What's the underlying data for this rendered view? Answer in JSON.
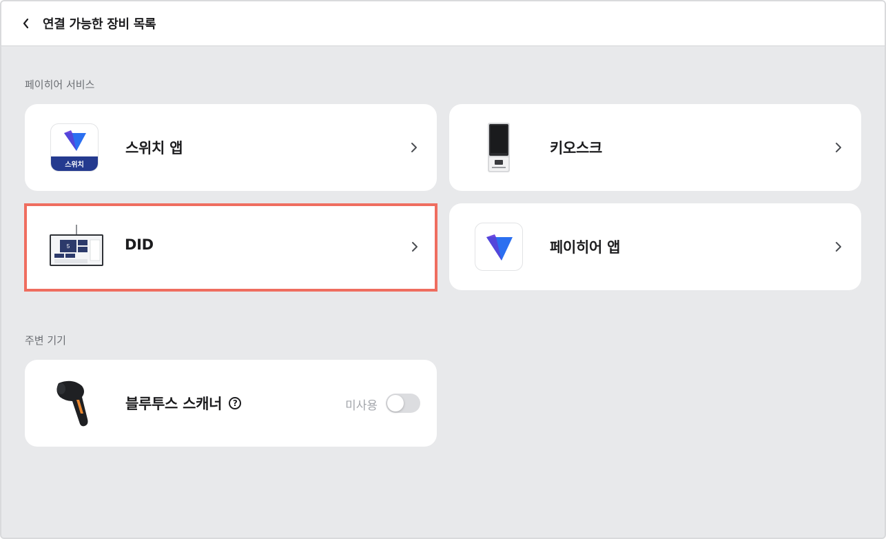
{
  "header": {
    "back_icon": "chevron-left-icon",
    "title": "연결 가능한 장비 목록"
  },
  "sections": [
    {
      "title": "페이히어 서비스",
      "items": [
        {
          "label": "스위치 앱",
          "icon": "switch-app-icon",
          "icon_text": "스위치",
          "selected": false
        },
        {
          "label": "키오스크",
          "icon": "kiosk-icon",
          "selected": false
        },
        {
          "label": "DID",
          "icon": "did-display-icon",
          "did_number": "5",
          "selected": true
        },
        {
          "label": "페이히어 앱",
          "icon": "payhere-app-icon",
          "selected": false
        }
      ]
    },
    {
      "title": "주변 기기",
      "items": [
        {
          "label": "블루투스 스캐너",
          "icon": "barcode-scanner-icon",
          "help_icon": "question-circle-icon",
          "help_glyph": "?",
          "toggle_label": "미사용",
          "toggle_on": false
        }
      ]
    }
  ],
  "colors": {
    "background": "#e8e9eb",
    "card": "#ffffff",
    "selected_border": "#ef6d5f",
    "brand_blue": "#2b6ff0",
    "brand_navy": "#243a8f"
  }
}
